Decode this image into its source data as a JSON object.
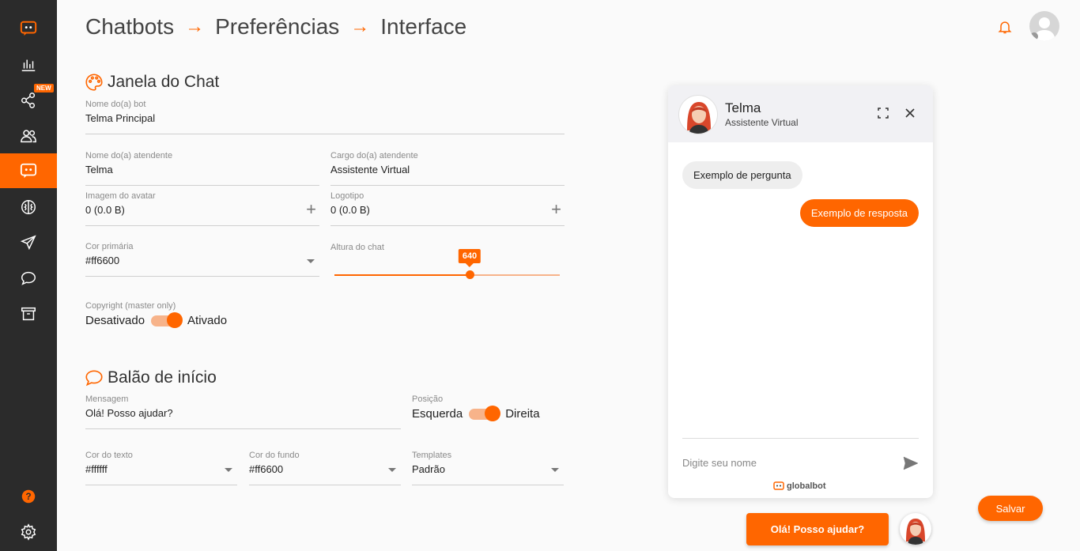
{
  "breadcrumb": [
    "Chatbots",
    "Preferências",
    "Interface"
  ],
  "sidebar": {
    "new_badge": "NEW",
    "icons": [
      "logo-icon",
      "stats-icon",
      "share-icon",
      "users-icon",
      "chatbot-icon",
      "brain-icon",
      "send-icon",
      "chat-icon",
      "archive-icon",
      "help-icon",
      "settings-icon"
    ],
    "active": "chatbot-icon"
  },
  "chat_window": {
    "title": "Janela do Chat",
    "bot_name_label": "Nome do(a) bot",
    "bot_name": "Telma Principal",
    "agent_name_label": "Nome do(a) atendente",
    "agent_name": "Telma",
    "agent_role_label": "Cargo do(a) atendente",
    "agent_role": "Assistente Virtual",
    "avatar_label": "Imagem do avatar",
    "avatar_value": "0 (0.0 B)",
    "logo_label": "Logotipo",
    "logo_value": "0 (0.0 B)",
    "primary_color_label": "Cor primária",
    "primary_color": "#ff6600",
    "height_label": "Altura do chat",
    "height_value": "640",
    "height_fraction": 0.6,
    "copyright_label": "Copyright (master only)",
    "copyright_off": "Desativado",
    "copyright_on": "Ativado"
  },
  "start_balloon": {
    "title": "Balão de início",
    "message_label": "Mensagem",
    "message": "Olá! Posso ajudar?",
    "position_label": "Posição",
    "position_left": "Esquerda",
    "position_right": "Direita",
    "text_color_label": "Cor do texto",
    "text_color": "#ffffff",
    "bg_color_label": "Cor do fundo",
    "bg_color": "#ff6600",
    "templates_label": "Templates",
    "template": "Padrão"
  },
  "preview": {
    "name": "Telma",
    "role": "Assistente Virtual",
    "question": "Exemplo de pergunta",
    "answer": "Exemplo de resposta",
    "input_placeholder": "Digite seu nome",
    "brand": "globalbot",
    "launcher_text": "Olá! Posso ajudar?"
  },
  "save_label": "Salvar",
  "colors": {
    "accent": "#ff6600",
    "sidebar": "#2b2b2b"
  }
}
